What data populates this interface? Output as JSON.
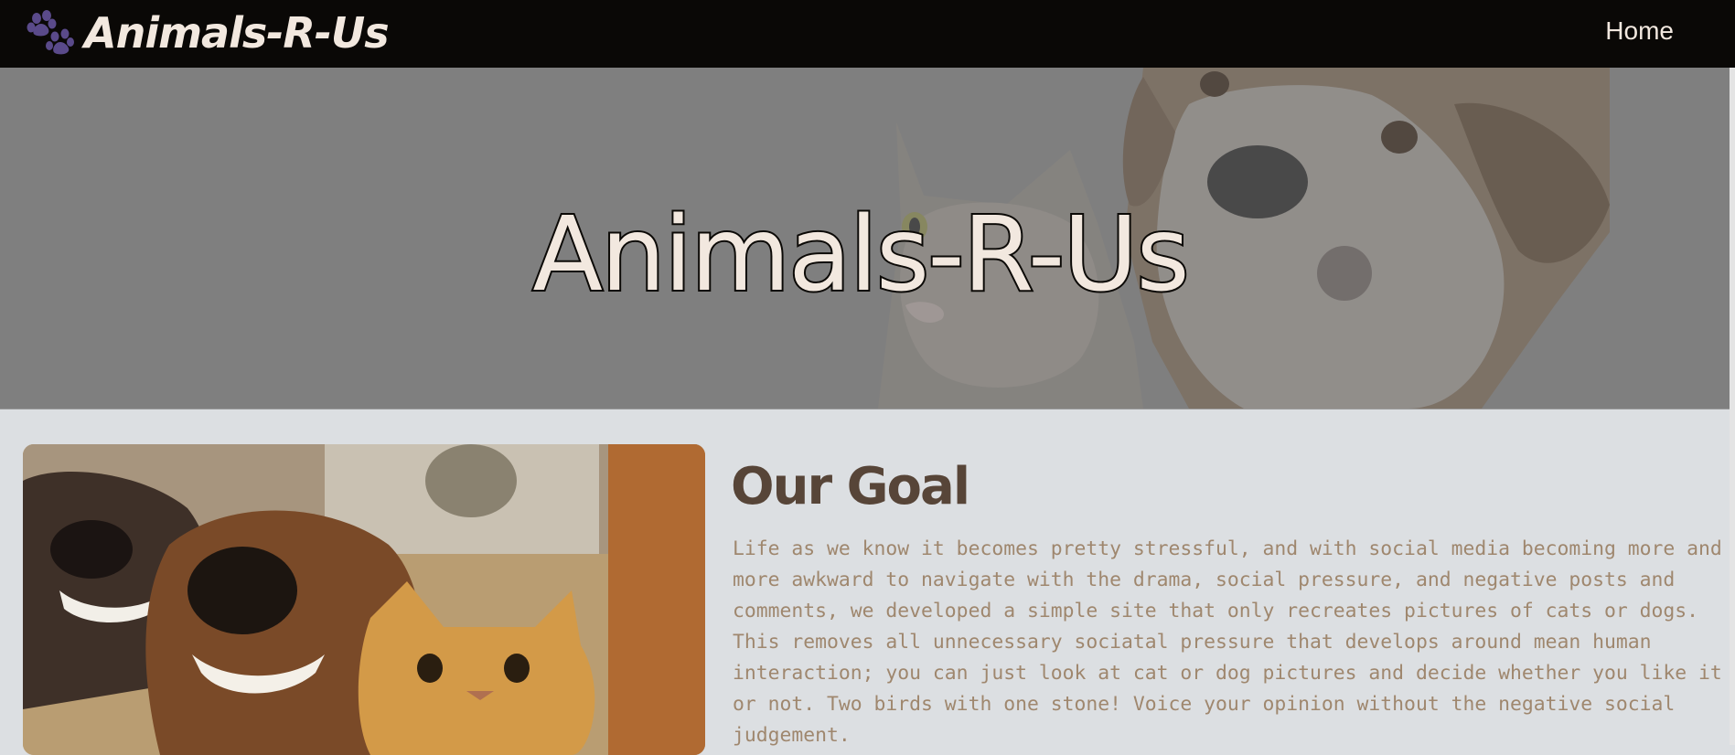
{
  "navbar": {
    "brand": "Animals-R-Us",
    "links": [
      {
        "label": "Home"
      }
    ]
  },
  "hero": {
    "title": "Animals-R-Us"
  },
  "main": {
    "goal_title": "Our Goal",
    "goal_text": "Life as we know it becomes pretty stressful, and with social media becoming more and more awkward to navigate with the drama, social pressure, and negative posts and comments, we developed a simple site that only recreates pictures of cats or dogs. This removes all unnecessary sociatal pressure that develops around mean human interaction; you can just look at cat or dog pictures and decide whether you like it or not. Two birds with one stone! Voice your opinion without the negative social judgement."
  },
  "colors": {
    "navbar_bg": "#0a0806",
    "page_bg": "#dcdfe2",
    "brand_text": "#f2e8df",
    "paw": "#5a4a8a",
    "heading": "#574538",
    "body_text": "#9f876e"
  },
  "icons": {
    "brand_icon": "paw-icon"
  }
}
